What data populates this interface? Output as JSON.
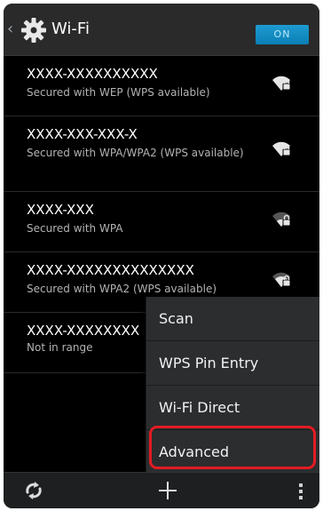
{
  "header": {
    "title": "Wi-Fi",
    "toggle_label": "ON"
  },
  "networks": [
    {
      "name": "XXXX-XXXXXXXXXX",
      "status": "Secured with WEP (WPS available)",
      "signal_icon": "wifi-locked-full-icon"
    },
    {
      "name": "XXXX-XXX-XXX-X",
      "status": "Secured with WPA/WPA2 (WPS available)",
      "signal_icon": "wifi-locked-full-icon"
    },
    {
      "name": "XXXX-XXX",
      "status": "Secured with WPA",
      "signal_icon": "wifi-locked-weak-icon"
    },
    {
      "name": "XXXX-XXXXXXXXXXXXXX",
      "status": "Secured with WPA2 (WPS available)",
      "signal_icon": "wifi-locked-medium-icon"
    },
    {
      "name": "XXXX-XXXXXXXX",
      "status": "Not in range"
    }
  ],
  "menu": {
    "items": [
      {
        "label": "Scan"
      },
      {
        "label": "WPS Pin Entry"
      },
      {
        "label": "Wi-Fi Direct"
      },
      {
        "label": "Advanced"
      }
    ],
    "highlighted_item": "Advanced",
    "highlight_color": "#e31b23"
  },
  "toolbar": {
    "left_icon": "refresh-icon",
    "center_icon": "add-network-icon",
    "right_icon": "overflow-menu-icon"
  },
  "colors": {
    "background": "#000000",
    "accent": "#0b7fb5",
    "text_primary": "#ffffff",
    "text_secondary": "#b3b3b3"
  }
}
